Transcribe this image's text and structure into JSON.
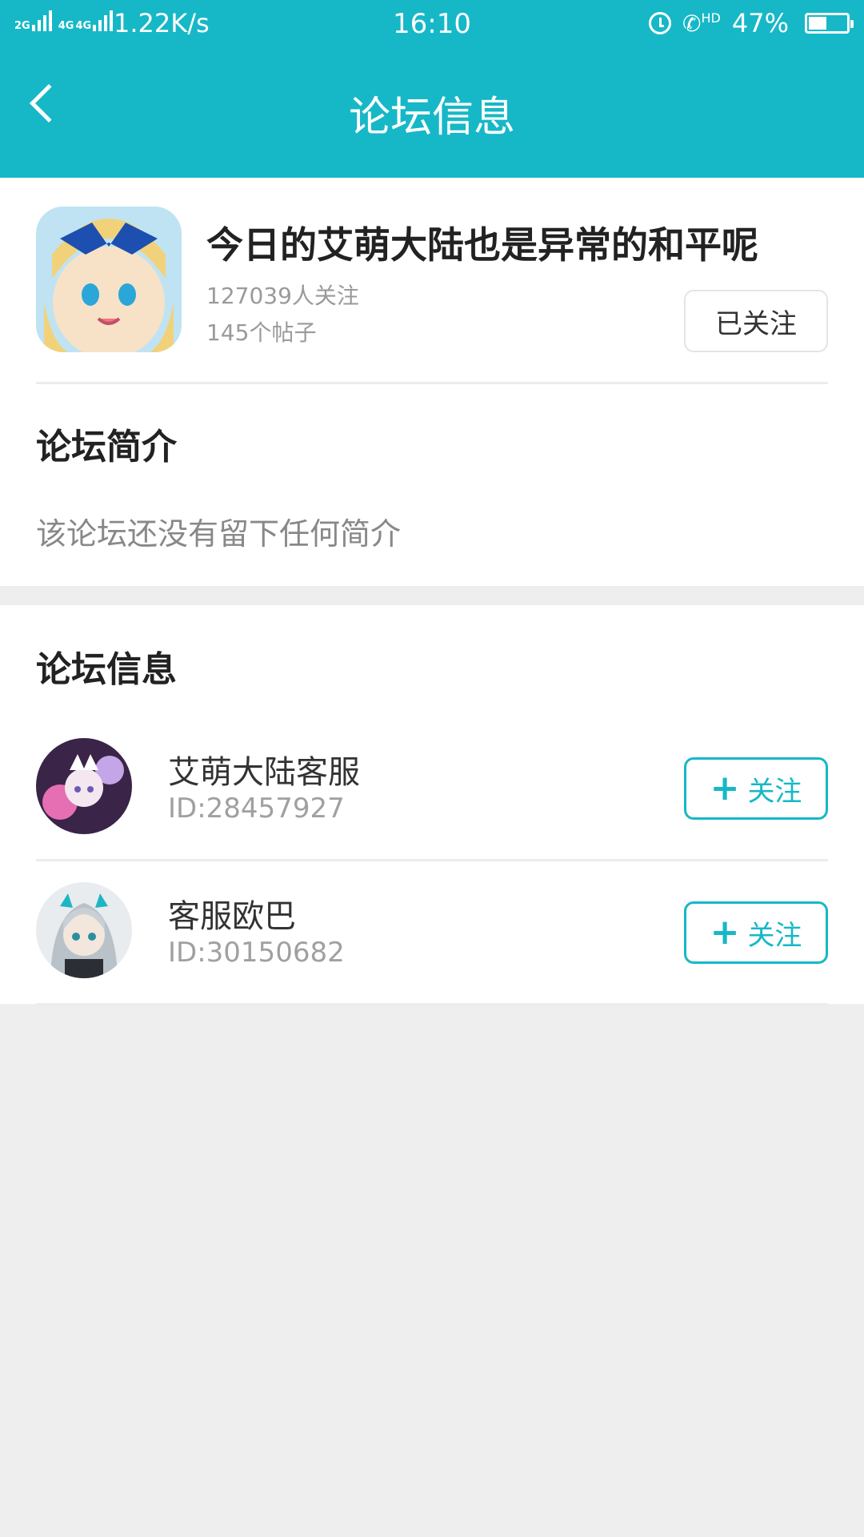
{
  "status_bar": {
    "sim1_type": "2G",
    "sim2_type": "4G",
    "sim2_type_b": "4G",
    "speed": "1.22K/s",
    "time": "16:10",
    "hd_label": "HD",
    "battery": "47%",
    "battery_level": 0.47
  },
  "header": {
    "title": "论坛信息"
  },
  "forum": {
    "name": "今日的艾萌大陆也是异常的和平呢",
    "followers": "127039人关注",
    "posts": "145个帖子",
    "followed_label": "已关注"
  },
  "intro": {
    "heading": "论坛简介",
    "text": "该论坛还没有留下任何简介"
  },
  "info": {
    "heading": "论坛信息",
    "moderators": [
      {
        "name": "艾萌大陆客服",
        "id": "ID:28457927",
        "follow_label": "关注"
      },
      {
        "name": "客服欧巴",
        "id": "ID:30150682",
        "follow_label": "关注"
      }
    ]
  },
  "colors": {
    "accent": "#16b8c7",
    "background": "#eeeeee"
  }
}
